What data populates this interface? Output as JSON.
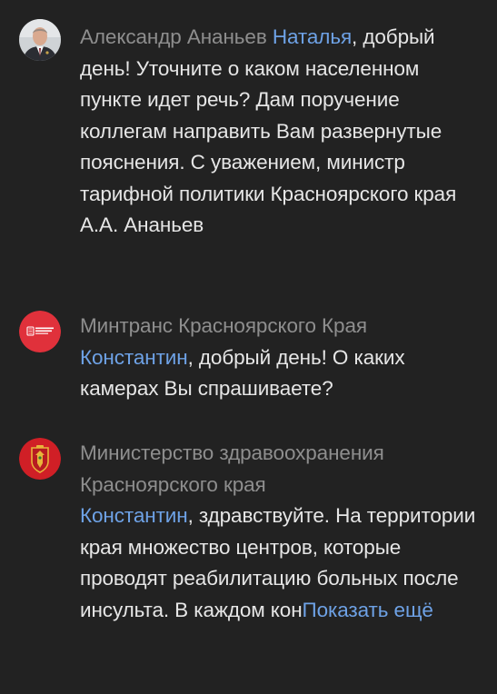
{
  "comments": [
    {
      "author": "Александр Ананьев",
      "mention": "Наталья",
      "body": ", добрый день! Уточните о каком населенном пункте идет речь? Дам поручение коллегам направить Вам развернутые пояснения. С уважением, министр тарифной политики Красноярского края А.А. Ананьев",
      "avatar_icon": "person-photo-avatar"
    },
    {
      "author": "Минтранс Красноярского Края",
      "mention": "Константин",
      "body": ", добрый день! О каких камерах Вы спрашиваете?",
      "avatar_icon": "mintrans-logo-avatar",
      "avatar_color": "#e0313b"
    },
    {
      "author": "Министерство здравоохранения Красноярского края",
      "mention": "Константин",
      "body": ", здравствуйте. На территории края множество центров, которые проводят реабилитацию больных после инсульта. В каждом кон",
      "more_label": "Показать ещё",
      "avatar_icon": "coat-of-arms-avatar",
      "avatar_color": "#d01f26"
    }
  ],
  "colors": {
    "background": "#222222",
    "text": "#e6e6e6",
    "author": "#8e8e8e",
    "link": "#6ea2e6"
  }
}
